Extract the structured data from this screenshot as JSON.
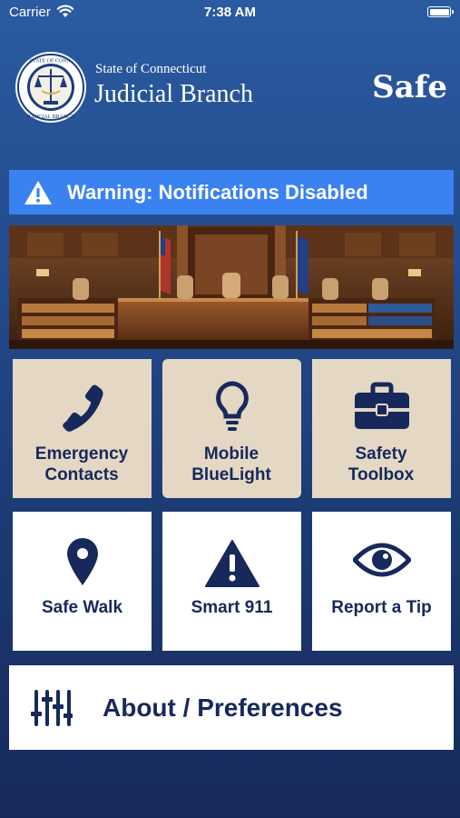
{
  "status_bar": {
    "carrier": "Carrier",
    "time": "7:38 AM",
    "battery_level": 1.0
  },
  "header": {
    "org_small": "State of Connecticut",
    "org_large": "Judicial Branch",
    "app_title": "Safe",
    "seal_text": "STATE OF CONNECTICUT · JUDICIAL BRANCH"
  },
  "warning": {
    "text": "Warning: Notifications Disabled",
    "icon": "warning-triangle-icon",
    "color": "#3a82f0"
  },
  "hero": {
    "description": ""
  },
  "tiles": [
    {
      "label": "Emergency Contacts",
      "icon": "phone-icon",
      "style": "beige"
    },
    {
      "label": "Mobile BlueLight",
      "icon": "lightbulb-icon",
      "style": "beige"
    },
    {
      "label": "Safety Toolbox",
      "icon": "toolbox-icon",
      "style": "beige"
    },
    {
      "label": "Safe Walk",
      "icon": "map-pin-icon",
      "style": "white"
    },
    {
      "label": "Smart 911",
      "icon": "alert-triangle-icon",
      "style": "white"
    },
    {
      "label": "Report a Tip",
      "icon": "eye-icon",
      "style": "white"
    }
  ],
  "about": {
    "label": "About / Preferences",
    "icon": "sliders-icon"
  },
  "colors": {
    "navy": "#17295a",
    "beige": "#e4d8c4",
    "accent_blue": "#3a82f0"
  }
}
